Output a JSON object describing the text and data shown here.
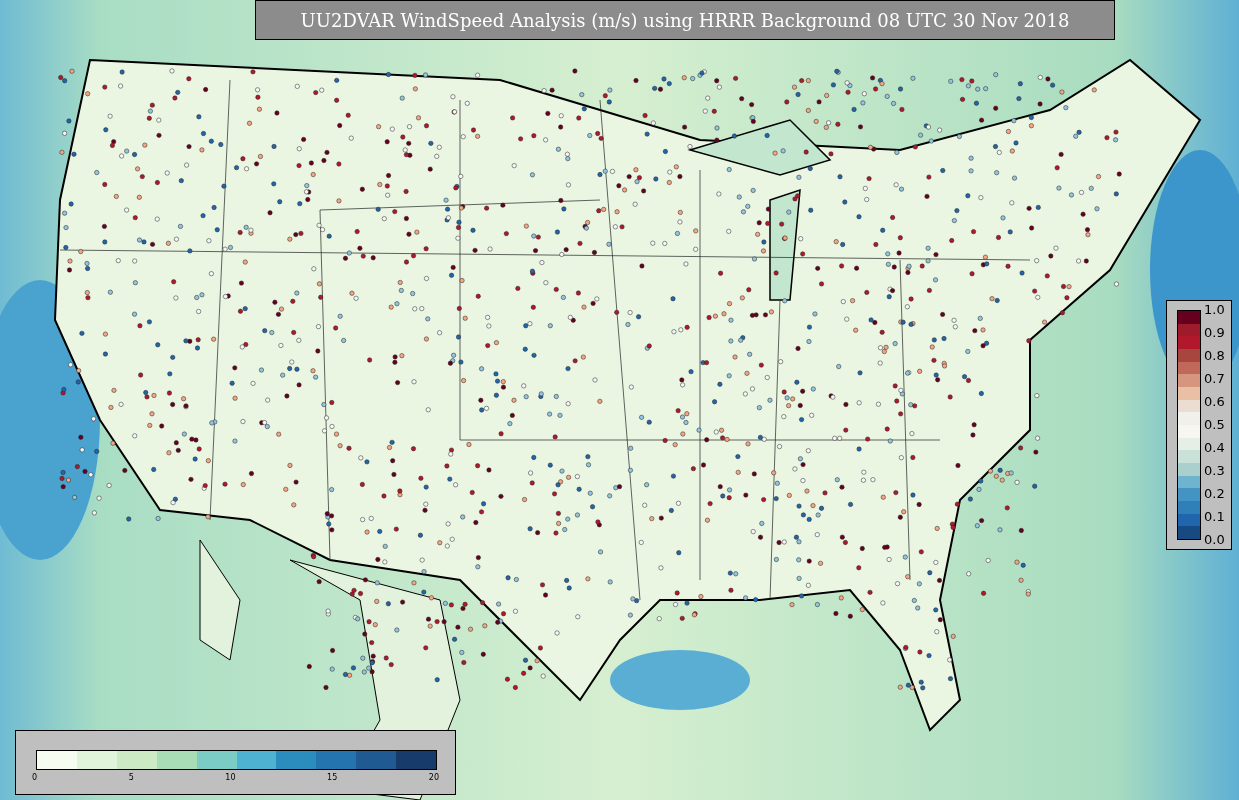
{
  "title": "UU2DVAR WindSpeed Analysis (m/s) using HRRR Background 08 UTC 30 Nov 2018",
  "ratio_colorbar": {
    "ticks": [
      "1.0",
      "0.9",
      "0.8",
      "0.7",
      "0.6",
      "0.5",
      "0.4",
      "0.3",
      "0.2",
      "0.1",
      "0.0"
    ]
  },
  "windspeed_colorbar": {
    "ticks": [
      "0",
      "5",
      "10",
      "15",
      "20"
    ]
  }
}
